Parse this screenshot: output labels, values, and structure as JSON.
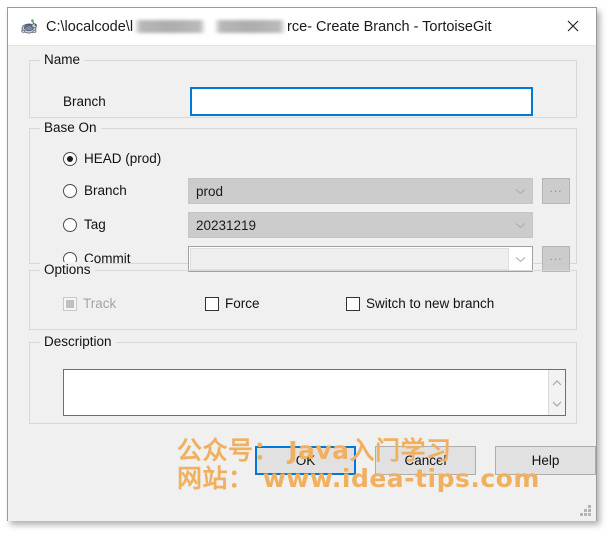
{
  "window": {
    "title_prefix": "C:\\localcode\\l",
    "title_middle": "rce",
    "title_suffix": " - Create Branch - TortoiseGit",
    "icon": "tortoisegit-turtle-icon",
    "close_label": "✕"
  },
  "name_group": {
    "legend": "Name",
    "branch_label": "Branch",
    "branch_value": "",
    "branch_placeholder": ""
  },
  "base_on_group": {
    "legend": "Base On",
    "options": [
      {
        "label": "HEAD (prod)",
        "selected": true
      },
      {
        "label": "Branch",
        "selected": false
      },
      {
        "label": "Tag",
        "selected": false
      },
      {
        "label": "Commit",
        "selected": false
      }
    ],
    "branch_combo_value": "prod",
    "tag_combo_value": "20231219",
    "commit_combo_value": "",
    "browse_label": "..."
  },
  "options_group": {
    "legend": "Options",
    "track_label": "Track",
    "force_label": "Force",
    "switch_label": "Switch to new branch"
  },
  "description_group": {
    "legend": "Description",
    "value": ""
  },
  "buttons": {
    "ok": "OK",
    "cancel": "Cancel",
    "help": "Help"
  },
  "watermark": {
    "line1": "公众号： Java入门学习",
    "line2": "网站： www.idea-tips.com",
    "color": "#f0b060"
  },
  "colors": {
    "accent": "#0078d7",
    "window_bg": "#f0f0f0",
    "titlebar_bg": "#ffffff"
  }
}
